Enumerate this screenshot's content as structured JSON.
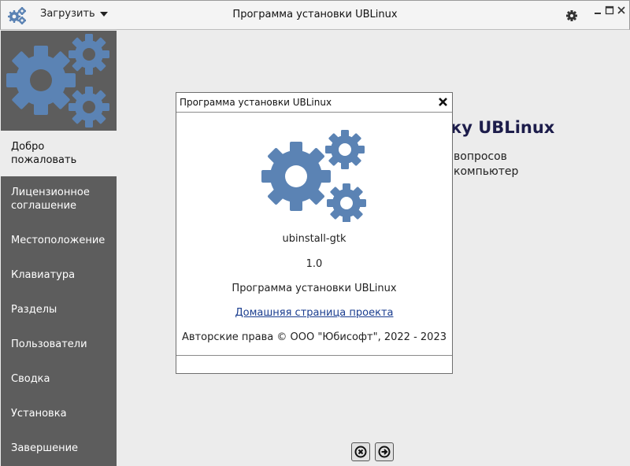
{
  "header": {
    "load_label": "Загрузить",
    "title": "Программа установки UBLinux",
    "icons": [
      "gear-cluster-icon",
      "settings-gear-icon",
      "minimize-icon",
      "maximize-icon",
      "close-icon"
    ]
  },
  "sidebar": {
    "items": [
      {
        "label": "Добро пожаловать",
        "active": true
      },
      {
        "label": "Лицензионное соглашение",
        "active": false
      },
      {
        "label": "Местоположение",
        "active": false
      },
      {
        "label": "Клавиатура",
        "active": false
      },
      {
        "label": "Разделы",
        "active": false
      },
      {
        "label": "Пользователи",
        "active": false
      },
      {
        "label": "Сводка",
        "active": false
      },
      {
        "label": "Установка",
        "active": false
      },
      {
        "label": "Завершение",
        "active": false
      }
    ]
  },
  "main": {
    "title_fragment": "ку UBLinux",
    "sub_line1": "вопросов",
    "sub_line2": "компьютер"
  },
  "about_dialog": {
    "title": "Программа установки UBLinux",
    "app_name": "ubinstall-gtk",
    "version": "1.0",
    "description": "Программа установки UBLinux",
    "homepage_label": "Домашняя страница проекта",
    "copyright": "Авторские права © ООО \"Юбисофт\", 2022 - 2023"
  },
  "colors": {
    "sidebar_bg": "#5d5d5d",
    "gear_blue": "#5b83b4",
    "active_item_bg": "#ececec",
    "title_text": "#1d1d4b"
  }
}
